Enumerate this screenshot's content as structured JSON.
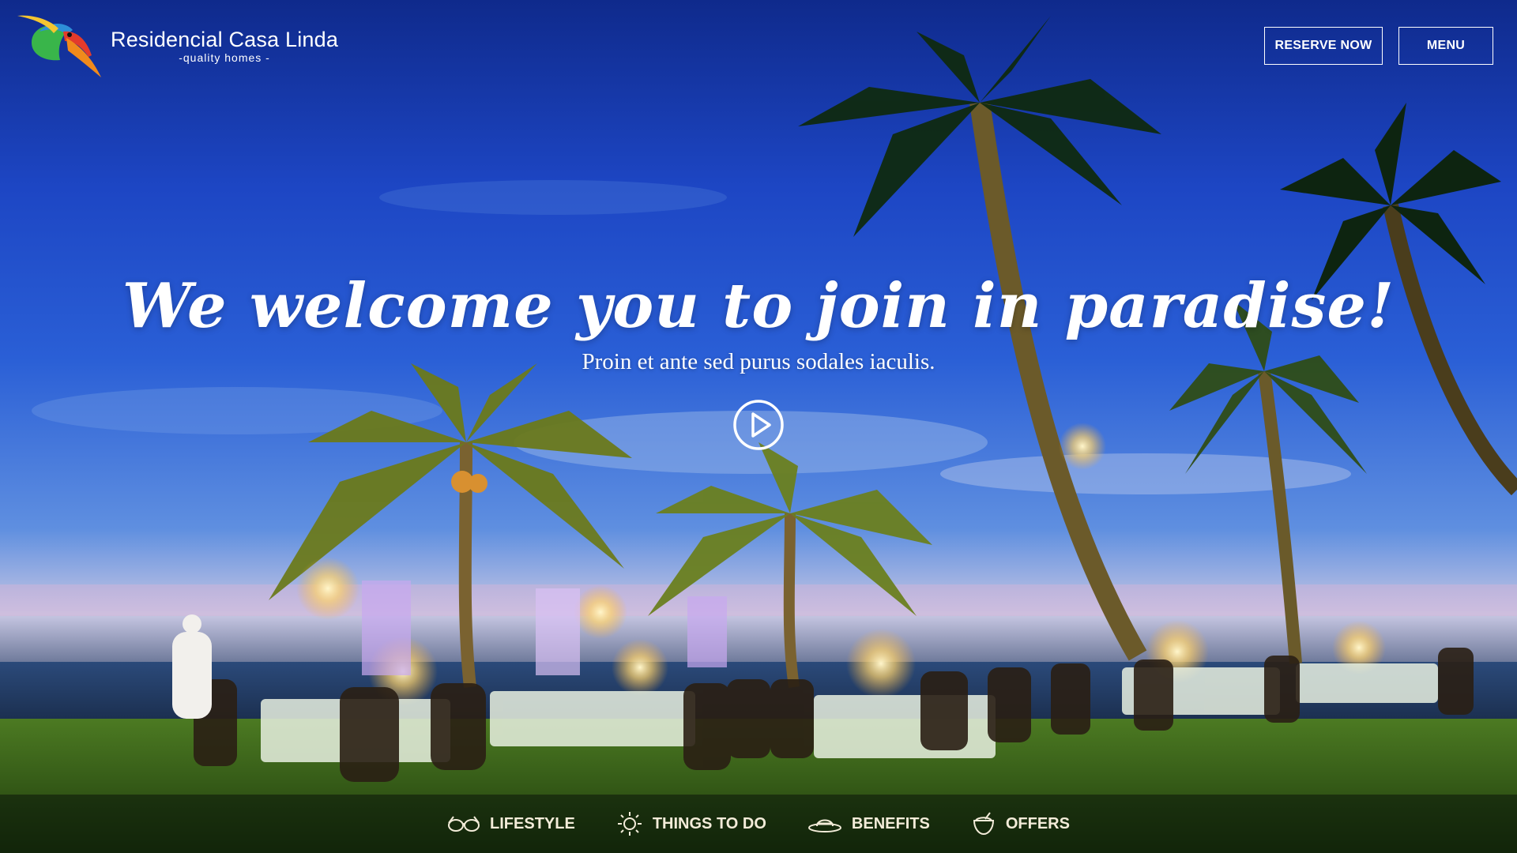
{
  "brand": {
    "name": "Residencial Casa Linda",
    "tagline": "-quality homes -"
  },
  "header": {
    "reserve_label": "RESERVE NOW",
    "menu_label": "MENU"
  },
  "hero": {
    "headline": "We welcome you to join in paradise!",
    "subline": "Proin et ante sed purus sodales iaculis.",
    "play_icon": "play-circle-icon"
  },
  "bottom_nav": {
    "items": [
      {
        "label": "LIFESTYLE",
        "icon": "glasses-icon"
      },
      {
        "label": "THINGS TO DO",
        "icon": "sun-icon"
      },
      {
        "label": "BENEFITS",
        "icon": "hat-icon"
      },
      {
        "label": "OFFERS",
        "icon": "coconut-drink-icon"
      }
    ]
  },
  "colors": {
    "sky": "#1d46c4",
    "button_border": "#ffffff",
    "nav_text": "#f3ecd9"
  }
}
